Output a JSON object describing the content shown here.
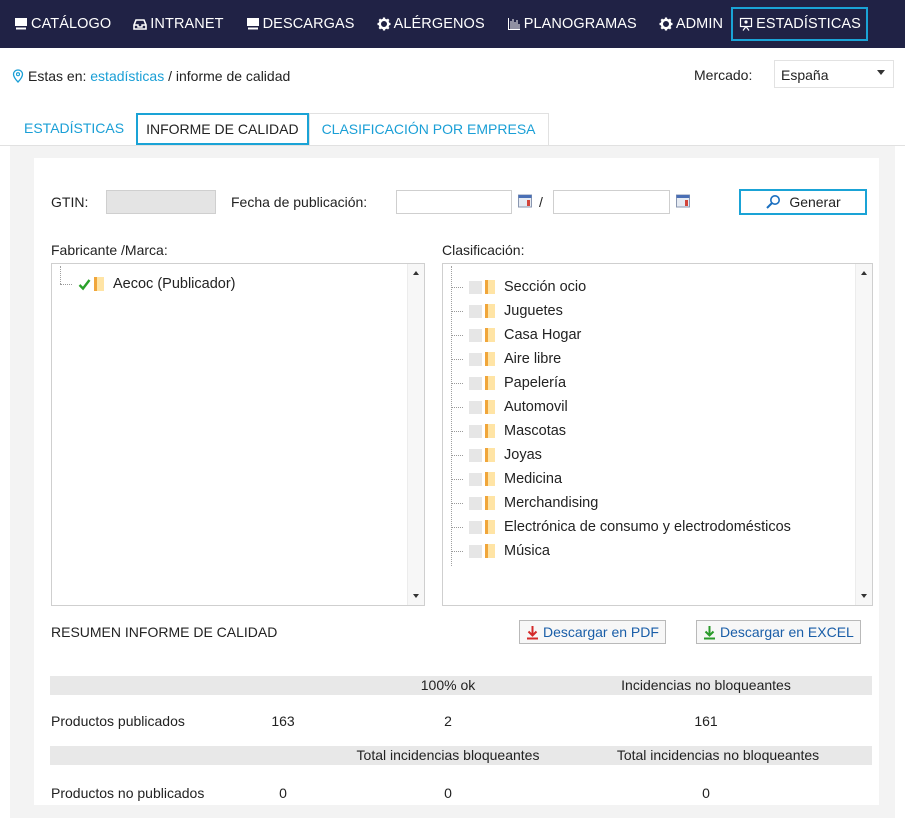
{
  "nav": {
    "items": [
      {
        "label": "CATÁLOGO",
        "icon": "monitor-icon"
      },
      {
        "label": "INTRANET",
        "icon": "inbox-icon"
      },
      {
        "label": "DESCARGAS",
        "icon": "monitor-icon"
      },
      {
        "label": "ALÉRGENOS",
        "icon": "gear-icon"
      },
      {
        "label": "PLANOGRAMAS",
        "icon": "bar-chart-icon"
      },
      {
        "label": "ADMIN",
        "icon": "gear-icon"
      },
      {
        "label": "ESTADÍSTICAS",
        "icon": "presentation-icon",
        "active": true
      }
    ]
  },
  "breadcrumb": {
    "prefix": "Estas en:",
    "link": "estadísticas",
    "current": "/ informe de calidad"
  },
  "market": {
    "label": "Mercado:",
    "value": "España"
  },
  "tabs": [
    {
      "label": "ESTADÍSTICAS"
    },
    {
      "label": "INFORME DE CALIDAD",
      "active": true
    },
    {
      "label": "CLASIFICACIÓN POR EMPRESA"
    }
  ],
  "filters": {
    "gtin_label": "GTIN:",
    "gtin_value": "",
    "date_label": "Fecha de publicación:",
    "date_from": "",
    "date_sep": "/",
    "date_to": "",
    "generate_label": "Generar"
  },
  "manufacturer": {
    "label": "Fabricante /Marca:",
    "items": [
      {
        "label": "Aecoc (Publicador)",
        "checked": true
      }
    ]
  },
  "classification": {
    "label": "Clasificación:",
    "items": [
      "Sección ocio",
      "Juguetes",
      "Casa Hogar",
      "Aire libre",
      "Papelería",
      "Automovil",
      "Mascotas",
      "Joyas",
      "Medicina",
      "Merchandising",
      "Electrónica de consumo y electrodomésticos",
      "Música"
    ]
  },
  "summary": {
    "title": "RESUMEN INFORME DE CALIDAD",
    "pdf_label": "Descargar en PDF",
    "excel_label": "Descargar en EXCEL",
    "header1": {
      "col_ok": "100% ok",
      "col_nonblocking": "Incidencias no bloqueantes"
    },
    "row1": {
      "label": "Productos publicados",
      "count": "163",
      "ok": "2",
      "nonblocking": "161"
    },
    "header2": {
      "col_blocking": "Total incidencias bloqueantes",
      "col_nonblocking": "Total incidencias no bloqueantes"
    },
    "row2": {
      "label": "Productos no publicados",
      "count": "0",
      "blocking": "0",
      "nonblocking": "0"
    }
  },
  "colors": {
    "nav_bg": "#202245",
    "accent": "#1aa3d6",
    "link": "#1a9fd6"
  }
}
